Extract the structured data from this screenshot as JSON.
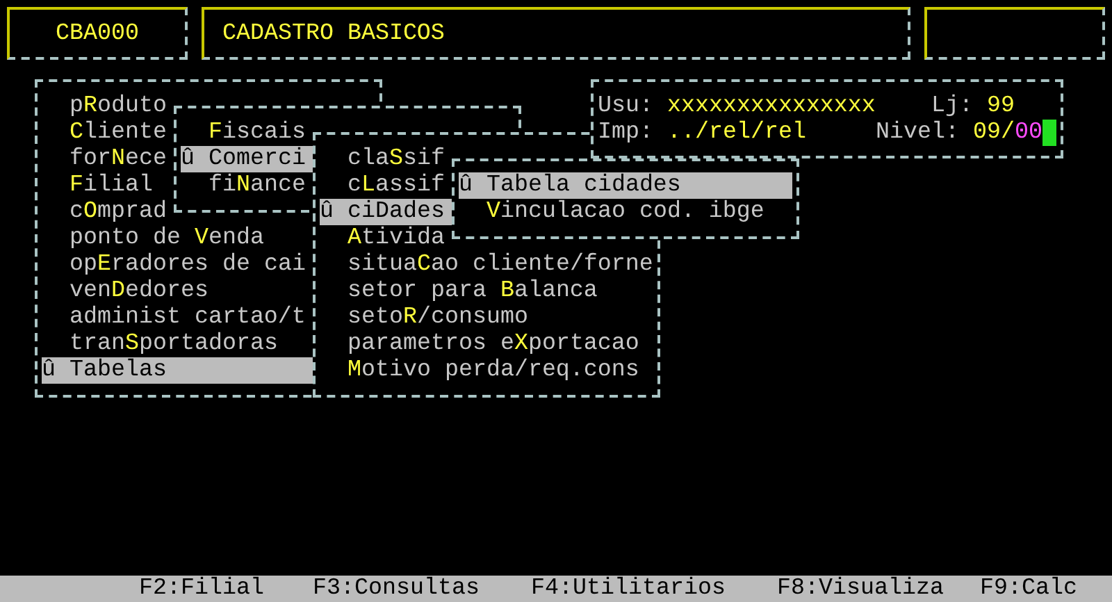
{
  "header": {
    "code": "CBA000",
    "title": "CADASTRO BASICOS"
  },
  "menus": [
    {
      "items": [
        {
          "label": "p**R**oduto",
          "selected": false
        },
        {
          "label": "**C**liente",
          "selected": false
        },
        {
          "label": "for**N**ece",
          "selected": false
        },
        {
          "label": "**F**ilial",
          "selected": false
        },
        {
          "label": "c**O**mprad",
          "selected": false
        },
        {
          "label": "ponto de **V**enda",
          "selected": false
        },
        {
          "label": "op**E**radores de cai",
          "selected": false
        },
        {
          "label": "ven**D**edores",
          "selected": false
        },
        {
          "label": "administ cartao/t",
          "selected": false
        },
        {
          "label": "tran**S**portadoras",
          "selected": false
        },
        {
          "label": "û Tabelas",
          "selected": true
        }
      ]
    },
    {
      "items": [
        {
          "label": "**F**iscais",
          "selected": false
        },
        {
          "label": "û Comerci",
          "selected": true
        },
        {
          "label": "fi**N**ance",
          "selected": false
        }
      ]
    },
    {
      "items": [
        {
          "label": "cla**S**sif",
          "selected": false
        },
        {
          "label": "c**L**assif",
          "selected": false
        },
        {
          "label": "û ciDades",
          "selected": true
        },
        {
          "label": "**A**tivida",
          "selected": false
        },
        {
          "label": "situa**C**ao cliente/forne",
          "selected": false
        },
        {
          "label": "setor para **B**alanca",
          "selected": false
        },
        {
          "label": "seto**R**/consumo",
          "selected": false
        },
        {
          "label": "parametros e**X**portacao",
          "selected": false
        },
        {
          "label": "**M**otivo perda/req.cons",
          "selected": false
        }
      ]
    },
    {
      "items": [
        {
          "label": "û Tabela cidades",
          "selected": true
        },
        {
          "label": "**V**inculacao cod. ibge",
          "selected": false
        }
      ]
    }
  ],
  "info": {
    "user_label": "Usu:",
    "user": "xxxxxxxxxxxxxxx",
    "store_label": "Lj:",
    "store": "99",
    "printer_label": "Imp:",
    "printer": "../rel/rel",
    "level_label": "Nivel:",
    "level": "09/",
    "level_suffix": "00"
  },
  "status_bar": [
    "F2:Filial",
    "F3:Consultas",
    "F4:Utilitarios",
    "F8:Visualiza",
    "F9:Calc"
  ]
}
